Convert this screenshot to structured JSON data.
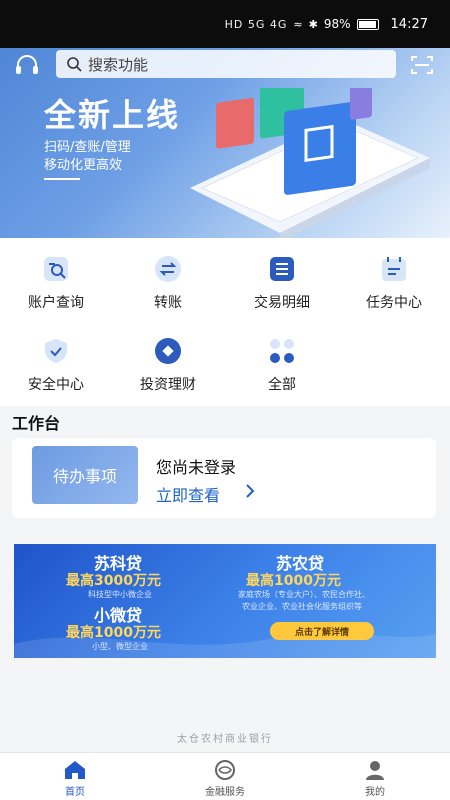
{
  "status_bar": {
    "network_icons": "HD 5G 4G",
    "battery": "98%",
    "time": "14:27"
  },
  "search": {
    "placeholder": "搜索功能"
  },
  "hero": {
    "title": "全新上线",
    "subtitle_line1": "扫码/查账/管理",
    "subtitle_line2": "移动化更高效"
  },
  "menu": {
    "items": [
      {
        "label": "账户查询",
        "icon": "account-query-icon"
      },
      {
        "label": "转账",
        "icon": "transfer-icon"
      },
      {
        "label": "交易明细",
        "icon": "transaction-detail-icon"
      },
      {
        "label": "任务中心",
        "icon": "task-center-icon"
      },
      {
        "label": "安全中心",
        "icon": "security-shield-icon"
      },
      {
        "label": "投资理财",
        "icon": "investment-icon"
      },
      {
        "label": "全部",
        "icon": "all-apps-icon"
      }
    ]
  },
  "workbench": {
    "title": "工作台",
    "badge": "待办事项",
    "not_logged_in": "您尚未登录",
    "view_now": "立即查看"
  },
  "banner": {
    "product1": "苏科贷",
    "product1_limit": "最高3000万元",
    "product1_target": "科技型中小微企业",
    "product2": "小微贷",
    "product2_limit": "最高1000万元",
    "product2_target": "小型、微型企业",
    "product3": "苏农贷",
    "product3_limit": "最高1000万元",
    "product3_target_line1": "家庭农场（专业大户）、农民合作社、",
    "product3_target_line2": "农业企业、农业社会化服务组织等",
    "cta": "点击了解详情"
  },
  "footer": {
    "bank_name": "太仓农村商业银行"
  },
  "tabbar": {
    "tabs": [
      {
        "label": "首页",
        "icon": "home-icon",
        "active": true
      },
      {
        "label": "金融服务",
        "icon": "finance-service-icon",
        "active": false
      },
      {
        "label": "我的",
        "icon": "profile-icon",
        "active": false
      }
    ]
  },
  "colors": {
    "accent": "#1e62c9",
    "hero_start": "#4f86d6",
    "banner_yellow": "#ffd75c"
  }
}
